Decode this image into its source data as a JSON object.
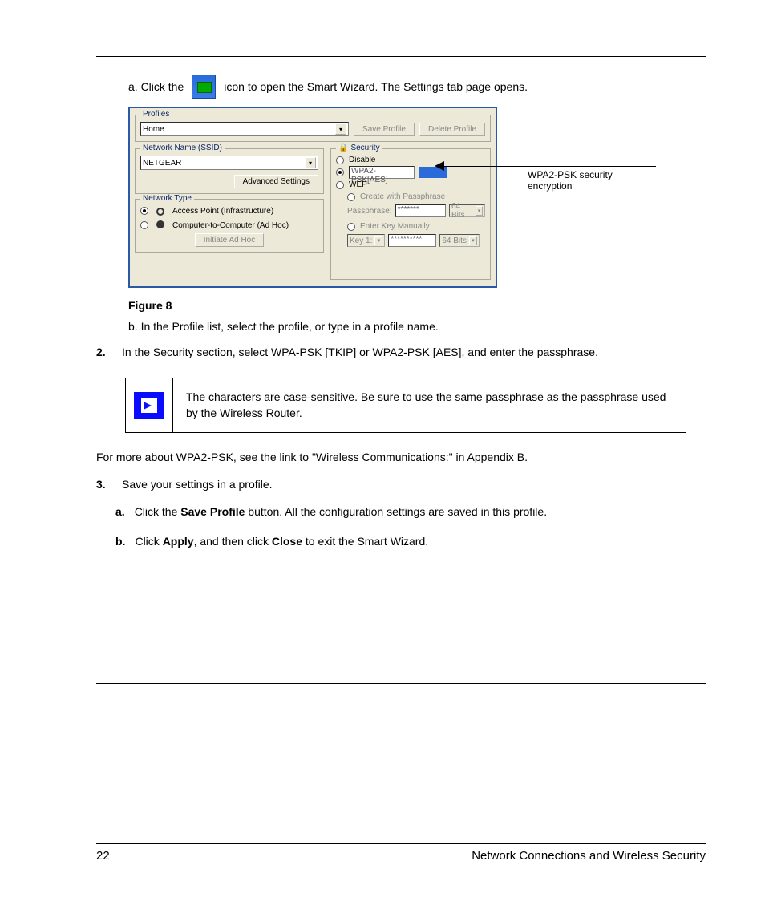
{
  "step_a_prefix": "a. Click the",
  "step_a_suffix": "icon to open the Smart Wizard. The Settings tab page opens.",
  "screenshot": {
    "profiles": {
      "legend": "Profiles",
      "selected": "Home",
      "save_btn": "Save Profile",
      "delete_btn": "Delete Profile"
    },
    "ssid": {
      "legend": "Network Name (SSID)",
      "value": "NETGEAR",
      "adv_btn": "Advanced Settings"
    },
    "nettype": {
      "legend": "Network Type",
      "ap": "Access Point (Infrastructure)",
      "adhoc": "Computer-to-Computer (Ad Hoc)",
      "initiate_btn": "Initiate Ad Hoc"
    },
    "security": {
      "legend": "Security",
      "disable": "Disable",
      "wpa_value": "WPA2-PSK[AES]",
      "wep": "WEP",
      "create_pass": "Create with Passphrase",
      "pass_label": "Passphrase:",
      "pass_value": "*******",
      "bits64": "64 Bits",
      "enter_manual": "Enter Key Manually",
      "key1": "Key 1:",
      "keyval": "**********"
    }
  },
  "callout": "WPA2-PSK security encryption",
  "fig_caption": "Figure 8",
  "step_b": "b. In the Profile list, select the profile, or type in a profile name.",
  "step2_num": "2.",
  "step2": "In the Security section, select WPA-PSK [TKIP] or WPA2-PSK [AES], and enter the passphrase.",
  "note_text": "The characters are case-sensitive. Be sure to use the same passphrase as the passphrase used by the Wireless Router.",
  "para": "For more about WPA2-PSK, see the link to \"Wireless Communications:\" in Appendix B.",
  "step3_num": "3.",
  "step3": "Save your settings in a profile.",
  "bullet_a_n": "a.",
  "bullet_a_pre": "Click the ",
  "bullet_a_bold": "Save Profile",
  "bullet_a_post": " button. All the configuration settings are saved in this profile.",
  "bullet_b_n": "b.",
  "bullet_b_pre": "Click ",
  "bullet_b_bold": "Apply",
  "bullet_b_post": ", and then click ",
  "bullet_b_bold2": "Close",
  "bullet_b_end": " to exit the Smart Wizard.",
  "footer_page": "22",
  "footer_title": "Network Connections and Wireless Security"
}
